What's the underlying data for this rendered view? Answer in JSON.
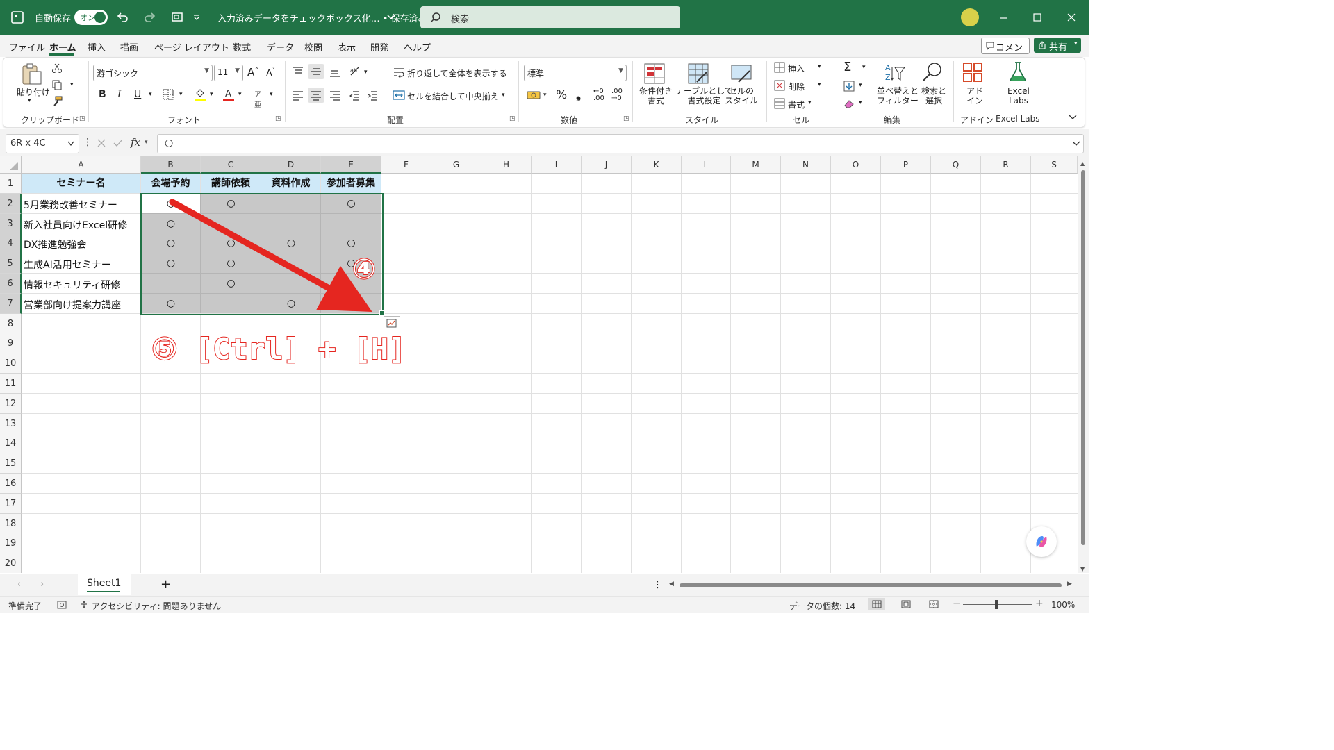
{
  "titlebar": {
    "autosave_label": "自動保存",
    "autosave_state": "オン",
    "doc_title": "入力済みデータをチェックボックス化… • 保存済み",
    "search_placeholder": "検索"
  },
  "menu": [
    "ファイル",
    "ホーム",
    "挿入",
    "描画",
    "ページ レイアウト",
    "数式",
    "データ",
    "校閲",
    "表示",
    "開発",
    "ヘルプ"
  ],
  "menu_active": "ホーム",
  "comment_button": "コメント",
  "share_button": "共有",
  "ribbon": {
    "clipboard": {
      "paste": "貼り付け",
      "group": "クリップボード"
    },
    "font": {
      "name": "游ゴシック",
      "size": "11",
      "bold": "B",
      "italic": "I",
      "underline": "U",
      "group": "フォント"
    },
    "alignment": {
      "wrap": "折り返して全体を表示する",
      "merge": "セルを結合して中央揃え",
      "group": "配置"
    },
    "number": {
      "format": "標準",
      "percent": "%",
      "comma": "❟",
      "group": "数値"
    },
    "styles": {
      "conditional": "条件付き\n書式",
      "table": "テーブルとして\n書式設定",
      "cellstyle": "セルの\nスタイル",
      "group": "スタイル"
    },
    "cells": {
      "insert": "挿入",
      "delete": "削除",
      "format": "書式",
      "group": "セル"
    },
    "editing": {
      "sort": "並べ替えと\nフィルター",
      "find": "検索と\n選択",
      "group": "編集"
    },
    "addins": {
      "label": "アド\nイン",
      "group": "アドイン"
    },
    "excellabs": {
      "label": "Excel\nLabs",
      "group": "Excel Labs"
    }
  },
  "formula_bar": {
    "name_box": "6R x 4C",
    "fx": "fx",
    "content": "○"
  },
  "columns": [
    "A",
    "B",
    "C",
    "D",
    "E",
    "F",
    "G",
    "H",
    "I",
    "J",
    "K",
    "L",
    "M",
    "N",
    "O",
    "P",
    "Q",
    "R",
    "S"
  ],
  "rows": [
    "1",
    "2",
    "3",
    "4",
    "5",
    "6",
    "7",
    "8",
    "9",
    "10",
    "11",
    "12",
    "13",
    "14",
    "15",
    "16",
    "17",
    "18",
    "19",
    "20"
  ],
  "table": {
    "headers": [
      "セミナー名",
      "会場予約",
      "講師依頼",
      "資料作成",
      "参加者募集"
    ],
    "rows": [
      {
        "name": "5月業務改善セミナー",
        "marks": [
          "○",
          "○",
          "",
          "○"
        ]
      },
      {
        "name": "新入社員向けExcel研修",
        "marks": [
          "○",
          "",
          "",
          ""
        ]
      },
      {
        "name": "DX推進勉強会",
        "marks": [
          "○",
          "○",
          "○",
          "○"
        ]
      },
      {
        "name": "生成AI活用セミナー",
        "marks": [
          "○",
          "○",
          "",
          "○"
        ]
      },
      {
        "name": "情報セキュリティ研修",
        "marks": [
          "",
          "○",
          "",
          ""
        ]
      },
      {
        "name": "営業部向け提案力講座",
        "marks": [
          "○",
          "",
          "○",
          ""
        ]
      }
    ]
  },
  "annotations": {
    "step4": "④",
    "step5": "⑤ [Ctrl] + [H]"
  },
  "sheet_tab": "Sheet1",
  "add_sheet": "+",
  "status": {
    "ready": "準備完了",
    "accessibility": "アクセシビリティ: 問題ありません",
    "count": "データの個数: 14",
    "zoom": "100%"
  },
  "colors": {
    "accent": "#217346",
    "header_fill": "#cfe9f8",
    "selection_fill": "#c8c8c8",
    "annotation_red": "#e52620"
  }
}
